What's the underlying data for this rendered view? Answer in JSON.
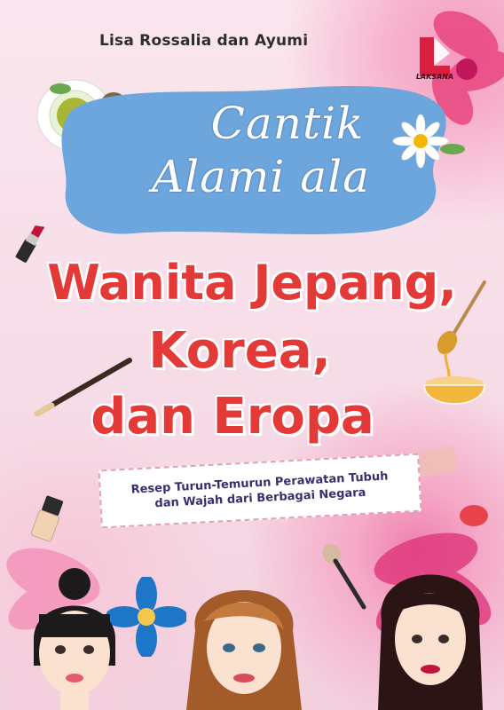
{
  "cover": {
    "author": "Lisa Rossalia dan Ayumi",
    "publisher": "LAKSANA",
    "title_script_line1": "Cantik",
    "title_script_line2": "Alami ala",
    "title_main_line1": "Wanita Jepang,",
    "title_main_line2": "Korea,",
    "title_main_line3": "dan Eropa",
    "subtitle_line1": "Resep Turun-Temurun Perawatan Tubuh",
    "subtitle_line2": "dan Wajah dari Berbagai Negara"
  },
  "colors": {
    "background_pink": "#f6dbe6",
    "blob_blue": "#6da6dc",
    "title_red": "#e33a37",
    "subtitle_navy": "#3a2e6e",
    "logo_red": "#d81f3e"
  },
  "icons": [
    "tea-cup-icon",
    "daisy-icon",
    "lipstick-icon",
    "brush-pencil-icon",
    "honey-bowl-icon",
    "foundation-bottle-icon",
    "makeup-sponge-icon",
    "makeup-brush-icon",
    "woman-face-icon"
  ]
}
